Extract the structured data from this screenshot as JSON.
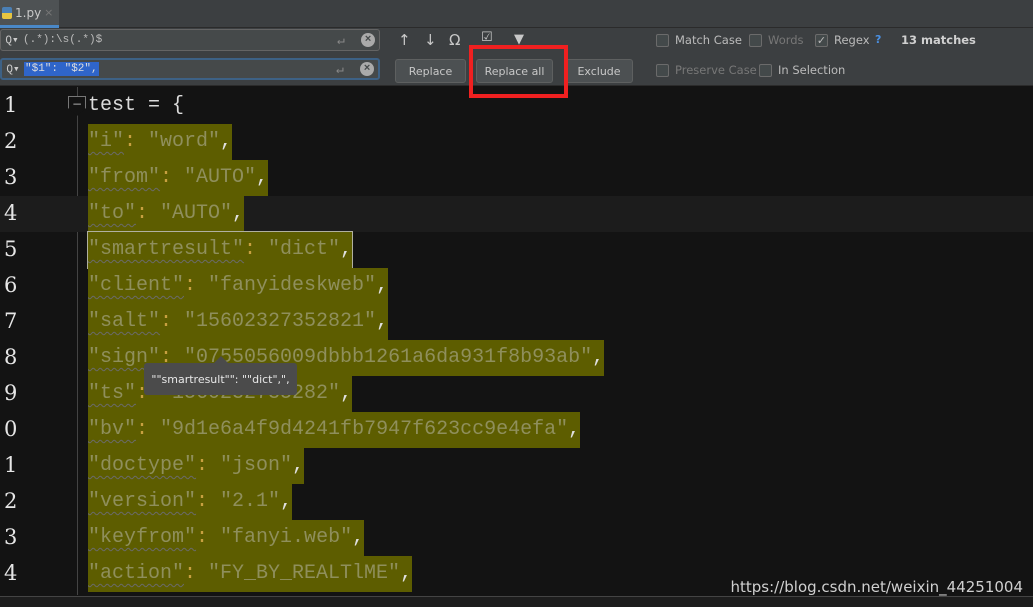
{
  "tab": {
    "filename": "1.py",
    "close": "×"
  },
  "find": {
    "search_value": "(.*):\\s(.*)$",
    "replace_value": "\"$1\": \"$2\",",
    "enter_icon": "↵",
    "clear_icon": "×",
    "search_icon": "Q▾"
  },
  "toolbar": {
    "prev": "↑",
    "next": "↓",
    "find_all": "Ω",
    "select_all": "☑",
    "filter": "▼",
    "replace_label": "Replace",
    "replace_all_label": "Replace all",
    "exclude_label": "Exclude"
  },
  "options": {
    "match_case": {
      "label": "Match Case",
      "checked": false
    },
    "words": {
      "label": "Words",
      "checked": false
    },
    "regex": {
      "label": "Regex",
      "checked": true,
      "check": "✓"
    },
    "help": "?",
    "matches": "13 matches",
    "preserve_case": {
      "label": "Preserve Case",
      "checked": false
    },
    "in_selection": {
      "label": "In Selection",
      "checked": false
    }
  },
  "highlight_color": "#f02020",
  "editor": {
    "first_line": {
      "number": "1",
      "text": "test = {"
    },
    "lines": [
      {
        "number": "2",
        "key": "\"i\"",
        "sep": ": ",
        "value": "\"word\"",
        "end": ","
      },
      {
        "number": "3",
        "key": "\"from\"",
        "sep": ": ",
        "value": "\"AUTO\"",
        "end": ","
      },
      {
        "number": "4",
        "key": "\"to\"",
        "sep": ": ",
        "value": "\"AUTO\"",
        "end": ","
      },
      {
        "number": "5",
        "key": "\"smartresult\"",
        "sep": ": ",
        "value": "\"dict\"",
        "end": ","
      },
      {
        "number": "6",
        "key": "\"client\"",
        "sep": ": ",
        "value": "\"fanyideskweb\"",
        "end": ","
      },
      {
        "number": "7",
        "key": "\"salt\"",
        "sep": ": ",
        "value": "\"15602327352821\"",
        "end": ","
      },
      {
        "number": "8",
        "key": "\"sign\"",
        "sep": ": ",
        "value": "\"0755056009dbbb1261a6da931f8b93ab\"",
        "end": ","
      },
      {
        "number": "9",
        "key": "\"ts\"",
        "sep": ": ",
        "value": "\"1560232735282\"",
        "end": ","
      },
      {
        "number": "0",
        "key": "\"bv\"",
        "sep": ": ",
        "value": "\"9d1e6a4f9d4241fb7947f623cc9e4efa\"",
        "end": ","
      },
      {
        "number": "1",
        "key": "\"doctype\"",
        "sep": ": ",
        "value": "\"json\"",
        "end": ","
      },
      {
        "number": "2",
        "key": "\"version\"",
        "sep": ": ",
        "value": "\"2.1\"",
        "end": ","
      },
      {
        "number": "3",
        "key": "\"keyfrom\"",
        "sep": ": ",
        "value": "\"fanyi.web\"",
        "end": ","
      },
      {
        "number": "4",
        "key": "\"action\"",
        "sep": ": ",
        "value": "\"FY_BY_REALTlME\"",
        "end": ","
      }
    ],
    "tooltip": "\"\"smartresult\"\": \"\"dict\",\","
  },
  "watermark": "https://blog.csdn.net/weixin_44251004"
}
